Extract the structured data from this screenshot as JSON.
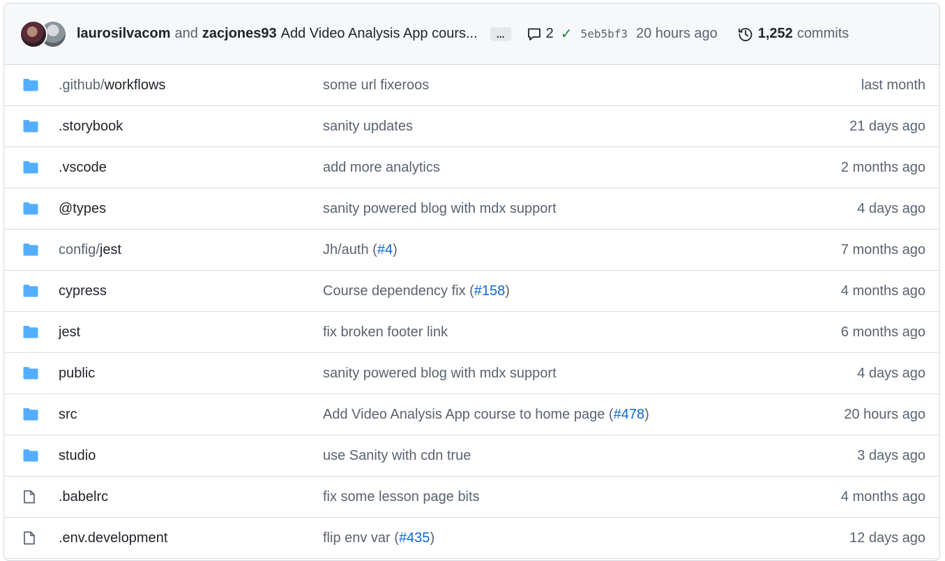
{
  "header": {
    "author1": "laurosilvacom",
    "conj": "and",
    "author2": "zacjones93",
    "message": "Add Video Analysis App cours...",
    "ellipsis": "...",
    "comments": "2",
    "sha": "5eb5bf3",
    "time": "20 hours ago",
    "commit_count": "1,252",
    "commit_label": "commits"
  },
  "rows": [
    {
      "type": "dir",
      "prefix": ".github/",
      "name": "workflows",
      "commit_pre": "some url fixeroos",
      "pr": "",
      "commit_post": "",
      "time": "last month"
    },
    {
      "type": "dir",
      "prefix": "",
      "name": ".storybook",
      "commit_pre": "sanity updates",
      "pr": "",
      "commit_post": "",
      "time": "21 days ago"
    },
    {
      "type": "dir",
      "prefix": "",
      "name": ".vscode",
      "commit_pre": "add more analytics",
      "pr": "",
      "commit_post": "",
      "time": "2 months ago"
    },
    {
      "type": "dir",
      "prefix": "",
      "name": "@types",
      "commit_pre": "sanity powered blog with mdx support",
      "pr": "",
      "commit_post": "",
      "time": "4 days ago"
    },
    {
      "type": "dir",
      "prefix": "config/",
      "name": "jest",
      "commit_pre": "Jh/auth (",
      "pr": "#4",
      "commit_post": ")",
      "time": "7 months ago"
    },
    {
      "type": "dir",
      "prefix": "",
      "name": "cypress",
      "commit_pre": "Course dependency fix (",
      "pr": "#158",
      "commit_post": ")",
      "time": "4 months ago"
    },
    {
      "type": "dir",
      "prefix": "",
      "name": "jest",
      "commit_pre": "fix broken footer link",
      "pr": "",
      "commit_post": "",
      "time": "6 months ago"
    },
    {
      "type": "dir",
      "prefix": "",
      "name": "public",
      "commit_pre": "sanity powered blog with mdx support",
      "pr": "",
      "commit_post": "",
      "time": "4 days ago"
    },
    {
      "type": "dir",
      "prefix": "",
      "name": "src",
      "commit_pre": "Add Video Analysis App course to home page (",
      "pr": "#478",
      "commit_post": ")",
      "time": "20 hours ago"
    },
    {
      "type": "dir",
      "prefix": "",
      "name": "studio",
      "commit_pre": "use Sanity with cdn true",
      "pr": "",
      "commit_post": "",
      "time": "3 days ago"
    },
    {
      "type": "file",
      "prefix": "",
      "name": ".babelrc",
      "commit_pre": "fix some lesson page bits",
      "pr": "",
      "commit_post": "",
      "time": "4 months ago"
    },
    {
      "type": "file",
      "prefix": "",
      "name": ".env.development",
      "commit_pre": "flip env var (",
      "pr": "#435",
      "commit_post": ")",
      "time": "12 days ago"
    }
  ]
}
